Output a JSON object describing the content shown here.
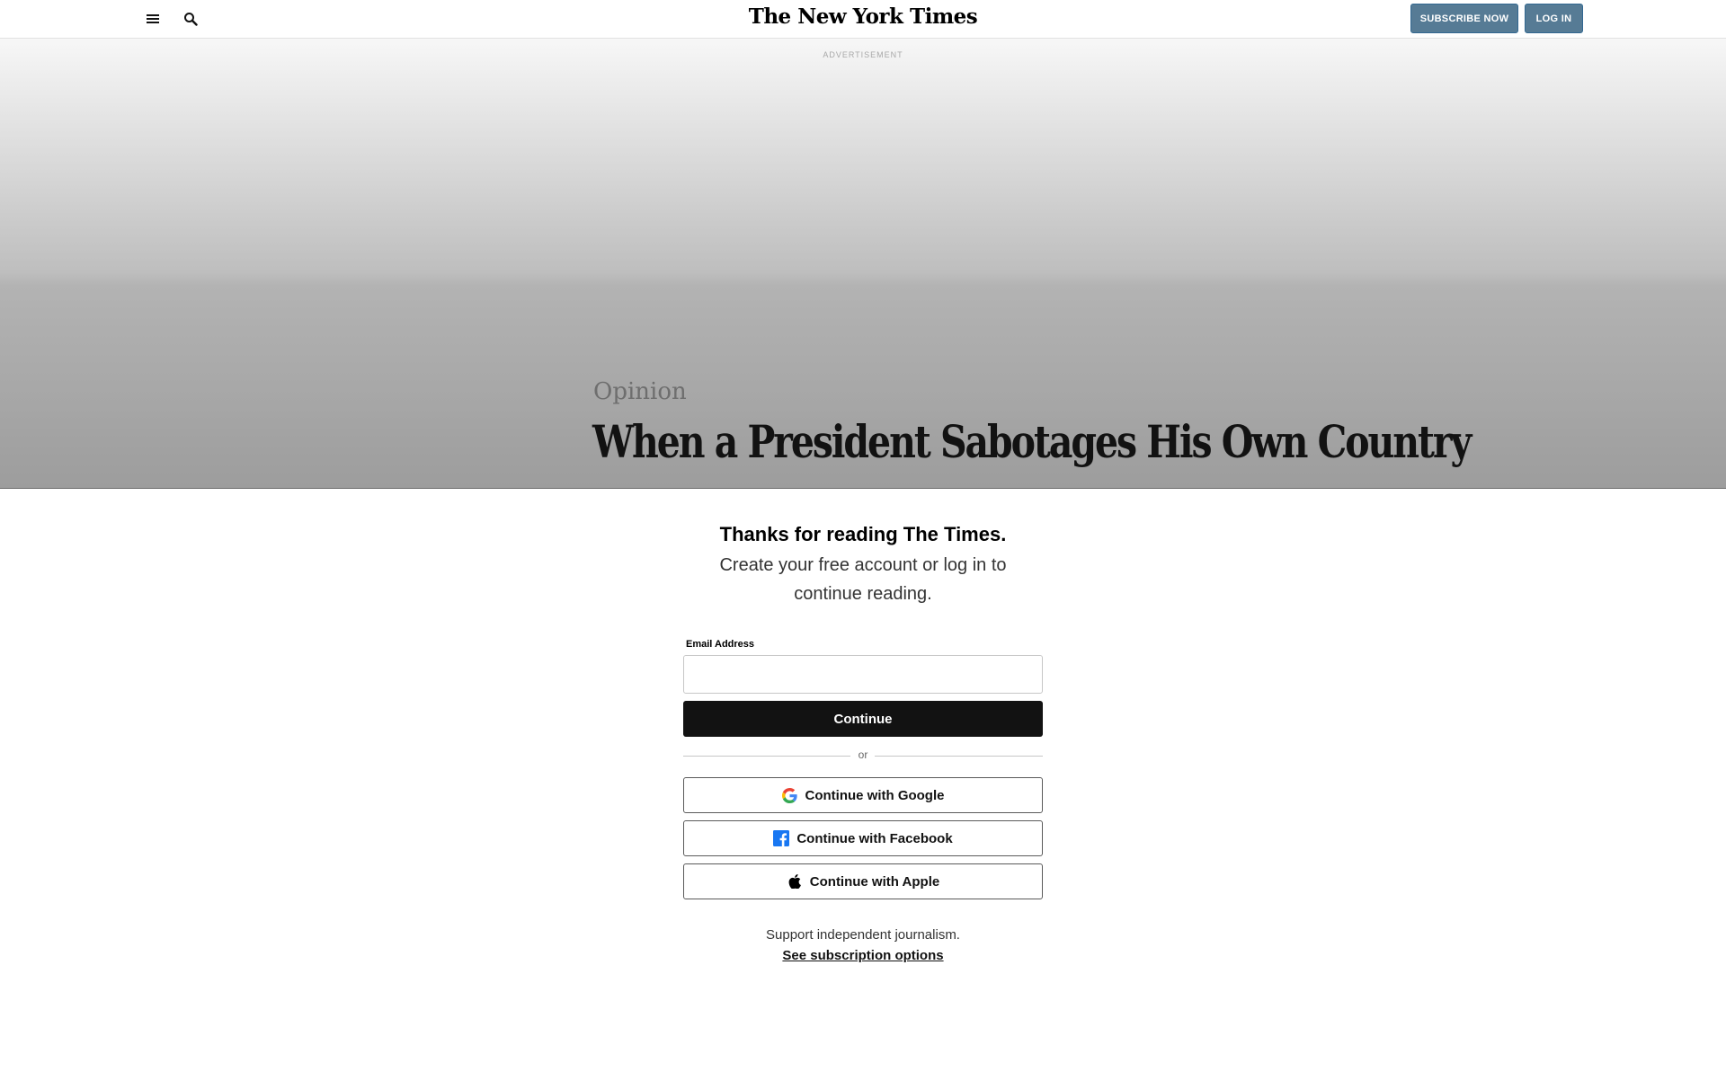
{
  "header": {
    "logo_text": "The New York Times",
    "subscribe_label": "SUBSCRIBE NOW",
    "login_label": "LOG IN"
  },
  "background": {
    "ad_label": "ADVERTISEMENT",
    "section": "Opinion",
    "headline": "When a President Sabotages His Own Country"
  },
  "modal": {
    "title": "Thanks for reading The Times.",
    "subtitle": "Create your free account or log in to continue reading.",
    "email_label": "Email Address",
    "email_value": "",
    "continue_label": "Continue",
    "or_text": "or",
    "google_label": "Continue with Google",
    "facebook_label": "Continue with Facebook",
    "apple_label": "Continue with Apple",
    "support_text": "Support independent journalism.",
    "subscription_link": "See subscription options"
  },
  "colors": {
    "header_button": "#567b95",
    "continue_button": "#121212",
    "facebook": "#1877f2"
  }
}
